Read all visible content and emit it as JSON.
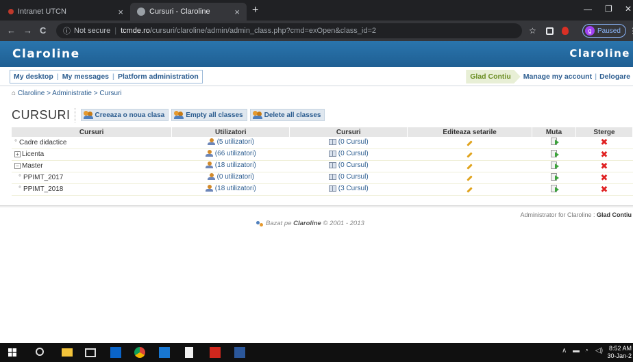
{
  "browser": {
    "tabs": [
      {
        "label": "Intranet UTCN",
        "active": false
      },
      {
        "label": "Cursuri - Claroline",
        "active": true
      }
    ],
    "tab_close": "×",
    "new_tab": "+",
    "window_controls": {
      "minimize": "—",
      "restore": "❐",
      "close": "✕"
    },
    "nav": {
      "back": "←",
      "forward": "→",
      "reload": "C"
    },
    "address": {
      "security": "Not secure",
      "host": "tcmde.ro",
      "path": "/cursuri/claroline/admin/admin_class.php?cmd=exOpen&class_id=2"
    },
    "profile": {
      "initial": "g",
      "status": "Paused"
    },
    "menu": "⋮"
  },
  "claroline": {
    "logo": "Claroline",
    "logo_right": "Claroline",
    "menu_left": [
      "My desktop",
      "My messages",
      "Platform administration"
    ],
    "user_name": "Glad Contiu",
    "menu_right": [
      "Manage my account",
      "Delogare"
    ],
    "breadcrumb": "Claroline > Administratie > Cursuri",
    "page_title": "CURSURI",
    "commands": [
      "Creeaza o noua clasa",
      "Empty all classes",
      "Delete all classes"
    ],
    "table": {
      "headers": [
        "Cursuri",
        "Utilizatori",
        "Cursuri",
        "Editeaza setarile",
        "Muta",
        "Sterge"
      ],
      "rows": [
        {
          "marker": "°",
          "name": "Cadre didactice",
          "users": "(5 utilizatori)",
          "courses": "(0 Cursul)",
          "indent": false
        },
        {
          "marker": "+",
          "name": "Licenta",
          "users": "(66 utilizatori)",
          "courses": "(0 Cursul)",
          "indent": false
        },
        {
          "marker": "−",
          "name": "Master",
          "users": "(18 utilizatori)",
          "courses": "(0 Cursul)",
          "indent": false
        },
        {
          "marker": "°",
          "name": "PPIMT_2017",
          "users": "(0 utilizatori)",
          "courses": "(0 Cursul)",
          "indent": true
        },
        {
          "marker": "°",
          "name": "PPIMT_2018",
          "users": "(18 utilizatori)",
          "courses": "(3 Cursul)",
          "indent": true
        }
      ],
      "delete_glyph": "✖"
    },
    "footer_admin_prefix": "Administrator for Claroline :",
    "footer_admin_name": "Glad Contiu",
    "footer_powered_prefix": "Bazat pe",
    "footer_powered_name": "Claroline",
    "footer_powered_suffix": "© 2001 - 2013"
  },
  "taskbar": {
    "time": "8:52 AM",
    "date": "30-Jan-2"
  },
  "colors": {
    "header_blue": "#1f5f93",
    "link_blue": "#2b5c8f",
    "user_green": "#6b8e23",
    "delete_red": "#e02020"
  }
}
